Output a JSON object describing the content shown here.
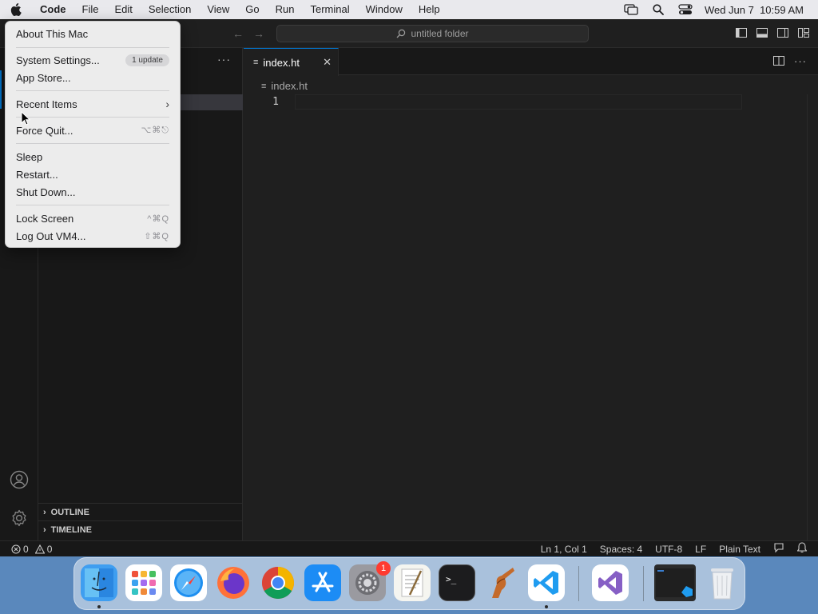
{
  "menubar": {
    "app_name": "Code",
    "items": [
      "File",
      "Edit",
      "Selection",
      "View",
      "Go",
      "Run",
      "Terminal",
      "Window",
      "Help"
    ],
    "datetime": "Wed Jun 7  10:59 AM"
  },
  "apple_menu": {
    "about": "About This Mac",
    "system_settings": "System Settings...",
    "update_badge": "1 update",
    "app_store": "App Store...",
    "recent_items": "Recent Items",
    "force_quit": "Force Quit...",
    "force_quit_shortcut": "⌥⌘⎋",
    "sleep": "Sleep",
    "restart": "Restart...",
    "shut_down": "Shut Down...",
    "lock_screen": "Lock Screen",
    "lock_screen_shortcut": "^⌘Q",
    "log_out": "Log Out VM4...",
    "log_out_shortcut": "⇧⌘Q"
  },
  "titlebar": {
    "search_text": "untitled folder"
  },
  "editor": {
    "tab_label": "index.ht",
    "breadcrumb_file": "index.ht",
    "line_number": "1"
  },
  "sidebar": {
    "sections": [
      "OUTLINE",
      "TIMELINE"
    ]
  },
  "statusbar": {
    "errors": "0",
    "warnings": "0",
    "position": "Ln 1, Col 1",
    "spaces": "Spaces: 4",
    "encoding": "UTF-8",
    "eol": "LF",
    "language": "Plain Text"
  },
  "dock": {
    "settings_badge": "1",
    "apps": [
      "finder-icon",
      "launchpad-icon",
      "safari-icon",
      "firefox-icon",
      "chrome-icon",
      "app-store-icon",
      "system-settings-icon",
      "textedit-icon",
      "terminal-icon",
      "instruments-icon",
      "vscode-icon",
      "visual-studio-icon",
      "vscode-window-thumbnail",
      "trash-icon"
    ]
  },
  "colors": {
    "accent": "#0078d4",
    "editor_bg": "#1f1f1f",
    "menu_bg": "#ececec"
  }
}
